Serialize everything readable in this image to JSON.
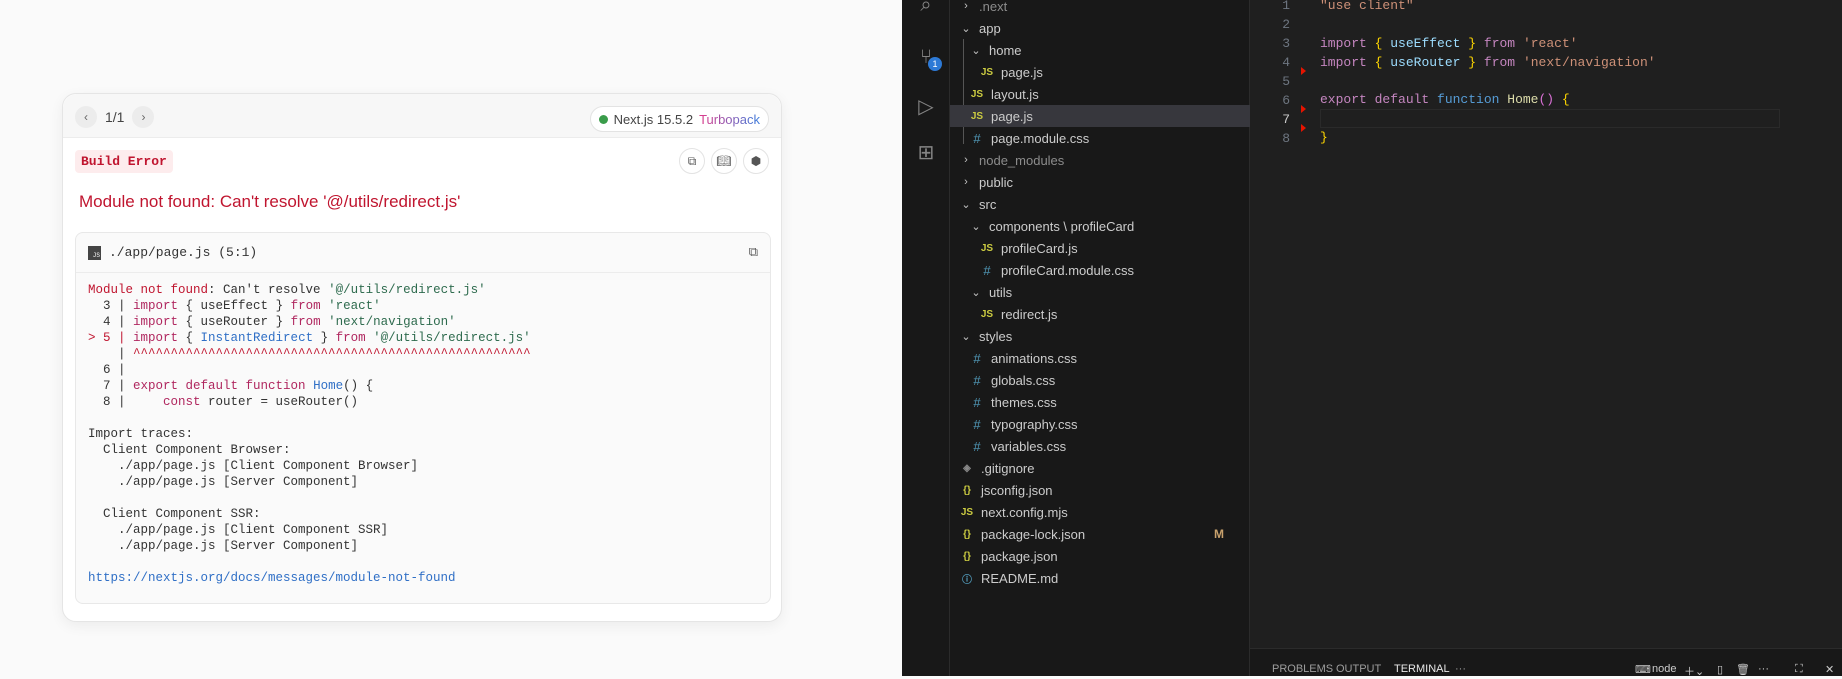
{
  "overlay": {
    "pager": "1/1",
    "version": "Next.js 15.5.2",
    "bundler": "Turbopack",
    "badge": "Build Error",
    "title": "Module not found: Can't resolve '@/utils/redirect.js'",
    "file": "./app/page.js (5:1)",
    "js_icon": "JS",
    "code": {
      "l0a": "Module not found",
      "l0b": ": Can't resolve ",
      "l0c": "'@/utils/redirect.js'",
      "imp": "import",
      "from": "from",
      "brace_open": " { ",
      "brace_close": " } ",
      "l3n": "  3 | ",
      "l3id": "useEffect",
      "l3s": "'react'",
      "l4n": "  4 | ",
      "l4id": "useRouter",
      "l4s": "'next/navigation'",
      "l5n": "> 5 | ",
      "l5id": "InstantRedirect",
      "l5s": "'@/utils/redirect.js'",
      "caret_pipe": "    | ",
      "carets": "^^^^^^^^^^^^^^^^^^^^^^^^^^^^^^^^^^^^^^^^^^^^^^^^^^^^^",
      "l6": "  6 |",
      "l7n": "  7 | ",
      "l7kw": "export default function",
      "l7fn": "Home",
      "l7rest": "() {",
      "l8n": "  8 |     ",
      "l8kw": "const",
      "l8rest": " router = useRouter()",
      "traces": "Import traces:\n  Client Component Browser:\n    ./app/page.js [Client Component Browser]\n    ./app/page.js [Server Component]\n\n  Client Component SSR:\n    ./app/page.js [Client Component SSR]\n    ./app/page.js [Server Component]",
      "link": "https://nextjs.org/docs/messages/module-not-found"
    }
  },
  "vscode": {
    "scm_badge": "1",
    "tree": [
      {
        "label": ".next",
        "type": "folder",
        "open": false,
        "depth": 0,
        "dim": true
      },
      {
        "label": "app",
        "type": "folder",
        "open": true,
        "depth": 0
      },
      {
        "label": "home",
        "type": "folder",
        "open": true,
        "depth": 1
      },
      {
        "label": "page.js",
        "type": "js",
        "depth": 2
      },
      {
        "label": "layout.js",
        "type": "js",
        "depth": 1
      },
      {
        "label": "page.js",
        "type": "js",
        "depth": 1,
        "selected": true
      },
      {
        "label": "page.module.css",
        "type": "css",
        "depth": 1
      },
      {
        "label": "node_modules",
        "type": "folder",
        "open": false,
        "depth": 0,
        "dim": true
      },
      {
        "label": "public",
        "type": "folder",
        "open": false,
        "depth": 0
      },
      {
        "label": "src",
        "type": "folder",
        "open": true,
        "depth": 0
      },
      {
        "label": "components \\ profileCard",
        "type": "folder",
        "open": true,
        "depth": 1
      },
      {
        "label": "profileCard.js",
        "type": "js",
        "depth": 2
      },
      {
        "label": "profileCard.module.css",
        "type": "css",
        "depth": 2
      },
      {
        "label": "utils",
        "type": "folder",
        "open": true,
        "depth": 1
      },
      {
        "label": "redirect.js",
        "type": "js",
        "depth": 2
      },
      {
        "label": "styles",
        "type": "folder",
        "open": true,
        "depth": 0
      },
      {
        "label": "animations.css",
        "type": "css",
        "depth": 1
      },
      {
        "label": "globals.css",
        "type": "css",
        "depth": 1
      },
      {
        "label": "themes.css",
        "type": "css",
        "depth": 1
      },
      {
        "label": "typography.css",
        "type": "css",
        "depth": 1
      },
      {
        "label": "variables.css",
        "type": "css",
        "depth": 1
      },
      {
        "label": ".gitignore",
        "type": "git",
        "depth": 0
      },
      {
        "label": "jsconfig.json",
        "type": "json",
        "depth": 0
      },
      {
        "label": "next.config.mjs",
        "type": "js",
        "depth": 0
      },
      {
        "label": "package-lock.json",
        "type": "json",
        "depth": 0,
        "badge": "M"
      },
      {
        "label": "package.json",
        "type": "json",
        "depth": 0
      },
      {
        "label": "README.md",
        "type": "info",
        "depth": 0
      }
    ],
    "editor": {
      "line_numbers": [
        "1",
        "2",
        "3",
        "4",
        "5",
        "6",
        "7",
        "8"
      ],
      "l1": "\"use client\"",
      "imp": "import",
      "from": "from",
      "ob": "{",
      "cb": "}",
      "l3id": "useEffect",
      "l3s": "'react'",
      "l4id": "useRouter",
      "l4s": "'next/navigation'",
      "l6a": "export default",
      "l6b": "function",
      "l6c": "Home",
      "l6d": "()",
      "l6e": "{",
      "l8": "}"
    },
    "panel": {
      "tabs": [
        "PROBLEMS",
        "OUTPUT",
        "TERMINAL",
        "···"
      ],
      "terminal": "node",
      "more": "···"
    }
  }
}
